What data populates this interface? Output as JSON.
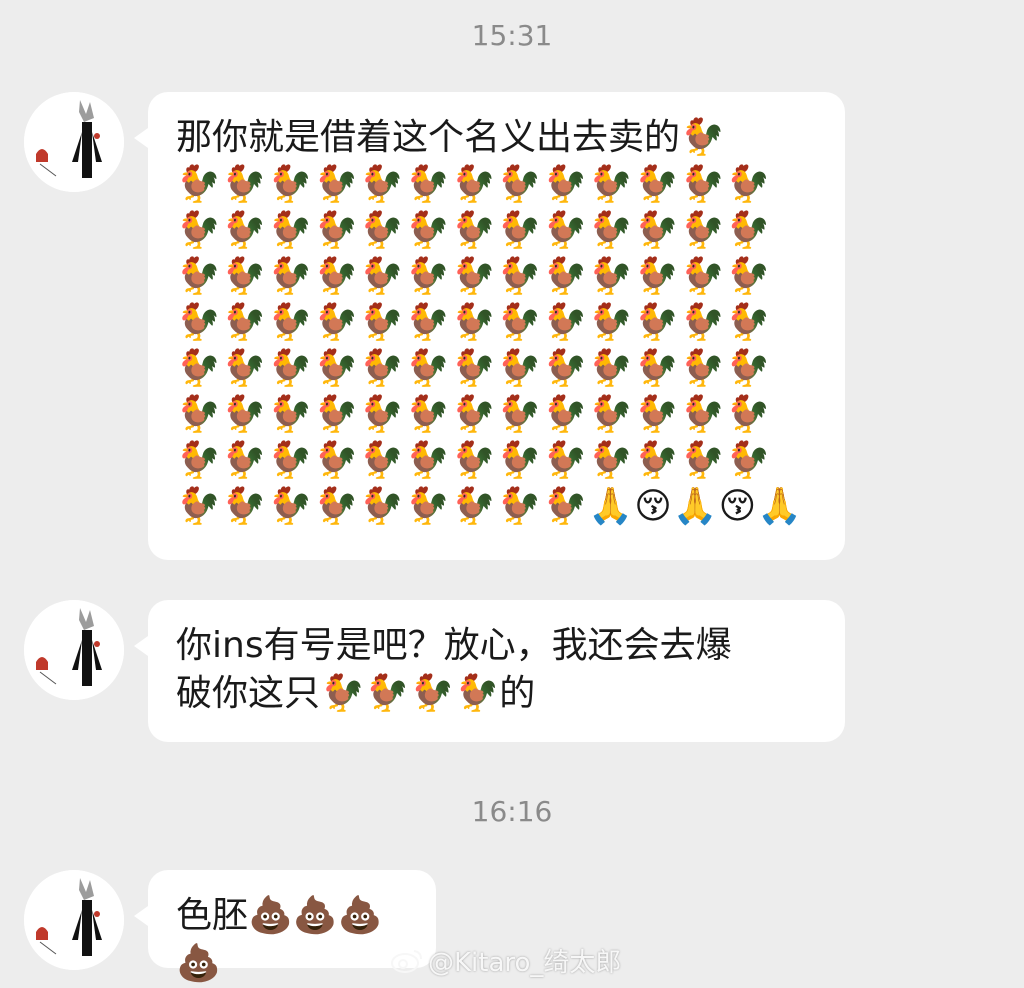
{
  "timestamps": [
    "15:31",
    "16:16"
  ],
  "messages": [
    {
      "text": "那你就是借着这个名义出去卖的🐓",
      "emoji_rows": [
        "🐓🐓🐓🐓🐓🐓🐓🐓🐓🐓🐓🐓🐓",
        "🐓🐓🐓🐓🐓🐓🐓🐓🐓🐓🐓🐓🐓",
        "🐓🐓🐓🐓🐓🐓🐓🐓🐓🐓🐓🐓🐓",
        "🐓🐓🐓🐓🐓🐓🐓🐓🐓🐓🐓🐓🐓",
        "🐓🐓🐓🐓🐓🐓🐓🐓🐓🐓🐓🐓🐓",
        "🐓🐓🐓🐓🐓🐓🐓🐓🐓🐓🐓🐓🐓",
        "🐓🐓🐓🐓🐓🐓🐓🐓🐓🐓🐓🐓🐓",
        "🐓🐓🐓🐓🐓🐓🐓🐓🐓🙏😚🙏😚🙏"
      ]
    },
    {
      "line1": "你ins有号是吧？放心，我还会去爆",
      "line2": "破你这只🐓🐓🐓🐓的"
    },
    {
      "text": "色胚💩💩💩💩"
    }
  ],
  "watermark": "@Kitaro_绮太郎",
  "colors": {
    "background": "#ededed",
    "bubble": "#ffffff",
    "timestamp": "#8a8a8a",
    "text": "#1a1a1a"
  },
  "icons": [
    "avatar",
    "weibo-logo-icon"
  ]
}
